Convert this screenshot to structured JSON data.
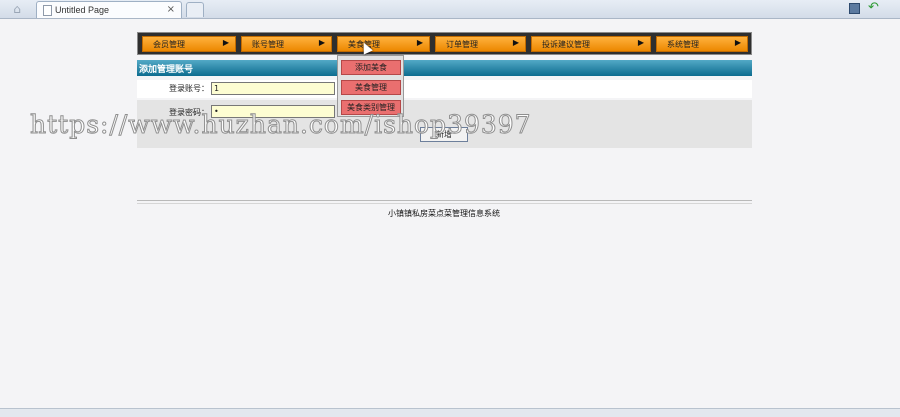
{
  "browser": {
    "tab_title": "Untitled Page",
    "tab_close": "×"
  },
  "nav": {
    "items": [
      {
        "label": "会员管理"
      },
      {
        "label": "账号管理"
      },
      {
        "label": "美食管理"
      },
      {
        "label": "订单管理"
      },
      {
        "label": "投诉建议管理"
      },
      {
        "label": "系统管理"
      }
    ],
    "arrow": "▶"
  },
  "dropdown": {
    "items": [
      {
        "label": "添加美食"
      },
      {
        "label": "美食管理"
      },
      {
        "label": "美食类别管理"
      }
    ]
  },
  "section": {
    "title": "添加管理账号"
  },
  "form": {
    "account_label": "登录账号：",
    "account_value": "1",
    "password_label": "登录密码：",
    "password_value": "•",
    "submit_label": "新增"
  },
  "footer": {
    "text": "小镇镇私房菜点菜管理信息系统"
  },
  "watermark": {
    "text": "https://www.huzhan.com/ishop39397"
  },
  "colors": {
    "nav_button": "#f59a1c",
    "section_header": "#1f7ea3",
    "dropdown_item": "#ea6f6f",
    "input_bg": "#fdfdd2"
  }
}
